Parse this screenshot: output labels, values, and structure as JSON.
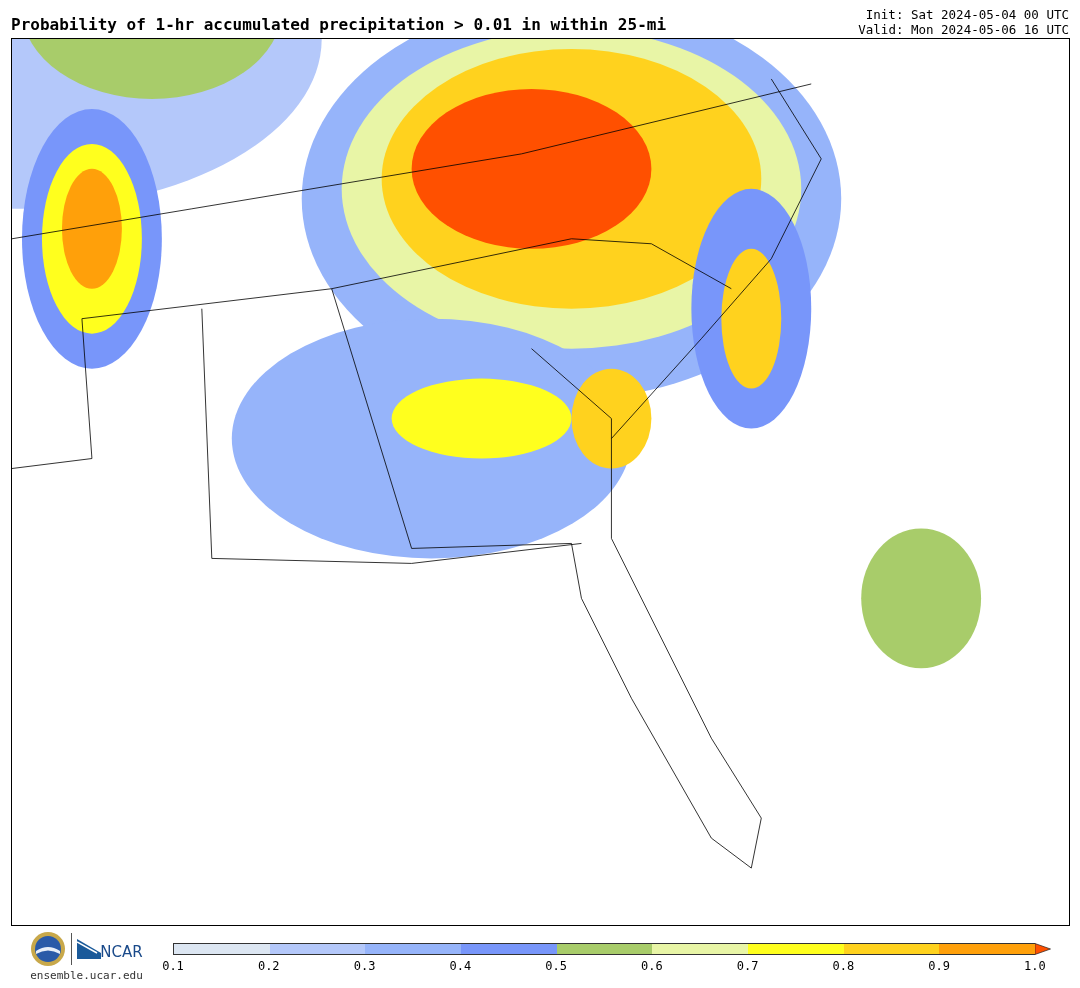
{
  "title": "Probability of 1-hr accumulated precipitation > 0.01 in within 25-mi",
  "run_info": [
    "Init: Sat 2024-05-04 00 UTC",
    "Valid: Mon 2024-05-06 16 UTC"
  ],
  "footer": {
    "logo_text": "NCAR",
    "site": "ensemble.ucar.edu"
  },
  "colorbar": {
    "bins": [
      {
        "color": "#dce6f2"
      },
      {
        "color": "#b4c8fa"
      },
      {
        "color": "#96b4fa"
      },
      {
        "color": "#7896fa"
      },
      {
        "color": "#a8cc6a"
      },
      {
        "color": "#e8f5a6"
      },
      {
        "color": "#ffff1e"
      },
      {
        "color": "#ffd21e"
      },
      {
        "color": "#ffa00a"
      }
    ],
    "extend": {
      "color": "#ff5000"
    },
    "ticks": [
      "0.1",
      "0.2",
      "0.3",
      "0.4",
      "0.5",
      "0.6",
      "0.7",
      "0.8",
      "0.9",
      "1.0"
    ]
  }
}
